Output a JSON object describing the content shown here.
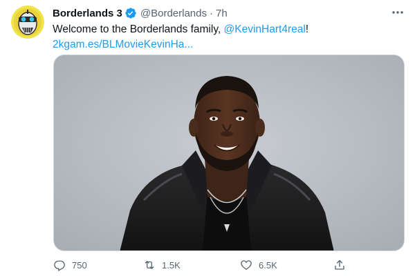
{
  "tweet": {
    "author": {
      "display_name": "Borderlands 3",
      "handle": "@Borderlands",
      "verified": true,
      "avatar_icon": "psycho-mask-avatar"
    },
    "separator": "·",
    "time": "7h",
    "text_prefix": "Welcome to the Borderlands family, ",
    "mention": "@KevinHart4real",
    "text_suffix": "!",
    "link": "2kgam.es/BLMovieKevinHa...",
    "media": {
      "description_icon": "photo-of-man-in-leather-jacket"
    },
    "stats": {
      "replies": "750",
      "retweets": "1.5K",
      "likes": "6.5K"
    }
  },
  "colors": {
    "accent": "#1d9bf0",
    "muted": "#536471",
    "text": "#0f1419"
  }
}
